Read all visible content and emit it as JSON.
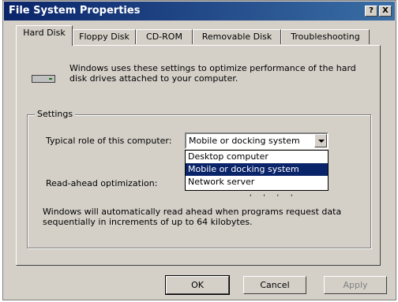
{
  "window": {
    "title": "File System Properties",
    "help_button": "?",
    "close_button": "X"
  },
  "tabs": [
    {
      "label": "Hard Disk",
      "active": true
    },
    {
      "label": "Floppy Disk",
      "active": false
    },
    {
      "label": "CD-ROM",
      "active": false
    },
    {
      "label": "Removable Disk",
      "active": false
    },
    {
      "label": "Troubleshooting",
      "active": false
    }
  ],
  "hard_disk": {
    "description": "Windows uses these settings to optimize performance of the hard disk drives attached to your computer.",
    "settings_group_label": "Settings",
    "typical_role_label": "Typical role of this computer:",
    "typical_role_selected": "Mobile or docking system",
    "typical_role_options": [
      "Desktop computer",
      "Mobile or docking system",
      "Network server"
    ],
    "read_ahead_label": "Read-ahead optimization:",
    "read_ahead_ticks": "' ' ' '",
    "help_text": "Windows will automatically read ahead when programs request data sequentially in increments of up to 64 kilobytes."
  },
  "buttons": {
    "ok": "OK",
    "cancel": "Cancel",
    "apply": "Apply"
  },
  "colors": {
    "titlebar_start": "#0a246a",
    "titlebar_end": "#3a6ea5",
    "face": "#d4d0c8",
    "selection": "#0a246a"
  }
}
